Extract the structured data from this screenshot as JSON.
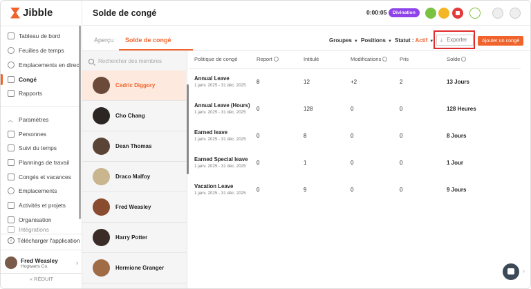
{
  "brand": {
    "name": "Jibble"
  },
  "sidebar": {
    "items_top": [
      {
        "label": "Tableau de bord",
        "icon": "grid-icon"
      },
      {
        "label": "Feuilles de temps",
        "icon": "clock-icon"
      },
      {
        "label": "Emplacements en direct",
        "icon": "map-pin-icon"
      },
      {
        "label": "Congé",
        "icon": "calendar-icon",
        "active": true
      },
      {
        "label": "Rapports",
        "icon": "report-icon"
      }
    ],
    "items_bottom": [
      {
        "label": "Paramètres",
        "icon": "chevron-up-icon"
      },
      {
        "label": "Personnes",
        "icon": "people-icon"
      },
      {
        "label": "Suivi du temps",
        "icon": "time-tracking-icon"
      },
      {
        "label": "Plannings de travail",
        "icon": "schedule-icon"
      },
      {
        "label": "Congés et vacances",
        "icon": "vacation-icon"
      },
      {
        "label": "Emplacements",
        "icon": "location-icon"
      },
      {
        "label": "Activités et projets",
        "icon": "tag-icon"
      },
      {
        "label": "Organisation",
        "icon": "organization-icon"
      },
      {
        "label": "Intégrations",
        "icon": "integrations-icon"
      }
    ],
    "download_label": "Télécharger l'application",
    "user": {
      "name": "Fred Weasley",
      "org": "Hogwarts Co."
    },
    "reduce_label": "RÉDUIT"
  },
  "header": {
    "title": "Solde de congé",
    "timer": "0:00:05",
    "badge": "Divination"
  },
  "toolbar": {
    "tabs": [
      "Aperçu",
      "Solde de congé"
    ],
    "filters": {
      "groups": "Groupes",
      "positions": "Positions",
      "status_label": "Statut :",
      "status_value": "Actif"
    },
    "export_label": "Exporter",
    "add_label": "Ajouter un congé"
  },
  "people": {
    "search_placeholder": "Rechercher des membres",
    "list": [
      {
        "name": "Cedric Diggory",
        "selected": true,
        "color": "#6b4a3a"
      },
      {
        "name": "Cho Chang",
        "color": "#2b2624"
      },
      {
        "name": "Dean Thomas",
        "color": "#5a4436"
      },
      {
        "name": "Draco Malfoy",
        "color": "#c9b58e"
      },
      {
        "name": "Fred Weasley",
        "color": "#8a4c2e"
      },
      {
        "name": "Harry Potter",
        "color": "#3a2c26"
      },
      {
        "name": "Hermione Granger",
        "color": "#a06c46"
      }
    ]
  },
  "table": {
    "headers": [
      "Politique de congé",
      "Report",
      "Intitulé",
      "Modifications",
      "Pris",
      "Solde"
    ],
    "rows": [
      {
        "policy": "Annual Leave",
        "dates": "1 janv. 2025 - 31 déc. 2025",
        "report": "8",
        "entitled": "12",
        "modifications": "+2",
        "taken": "2",
        "balance": "13 Jours"
      },
      {
        "policy": "Annual Leave (Hours)",
        "dates": "1 janv. 2025 - 31 déc. 2025",
        "report": "0",
        "entitled": "128",
        "modifications": "0",
        "taken": "0",
        "balance": "128 Heures"
      },
      {
        "policy": "Earned leave",
        "dates": "1 janv. 2025 - 31 déc. 2025",
        "report": "0",
        "entitled": "8",
        "modifications": "0",
        "taken": "0",
        "balance": "8 Jours"
      },
      {
        "policy": "Earned Special leave",
        "dates": "1 janv. 2025 - 31 déc. 2025",
        "report": "0",
        "entitled": "1",
        "modifications": "0",
        "taken": "0",
        "balance": "1 Jour"
      },
      {
        "policy": "Vacation Leave",
        "dates": "1 janv. 2025 - 31 déc. 2025",
        "report": "0",
        "entitled": "9",
        "modifications": "0",
        "taken": "0",
        "balance": "9 Jours"
      }
    ]
  },
  "colors": {
    "accent": "#f0632c",
    "badge": "#8e44e8",
    "highlight": "#e02b2b"
  }
}
